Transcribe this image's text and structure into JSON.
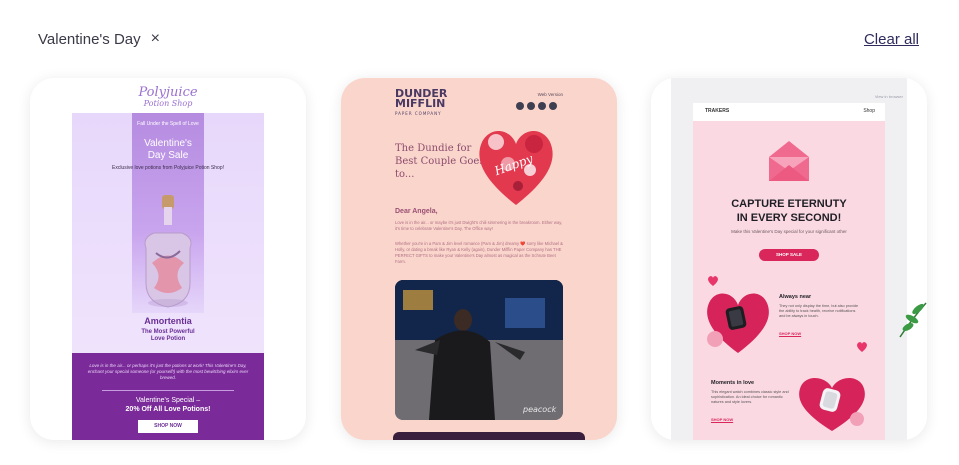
{
  "filter": {
    "chip_label": "Valentine's Day",
    "close_glyph": "×",
    "clear_label": "Clear all"
  },
  "cards": {
    "polyjuice": {
      "logo": "Polyjuice",
      "logo_sub": "Potion Shop",
      "kicker": "Fall Under the Spell of Love",
      "title_line1": "Valentine's",
      "title_line2": "Day Sale",
      "intro": "Exclusive love potions from Polyjuice Potion Shop!",
      "product": "Amortentia",
      "product_sub_1": "The Most Powerful",
      "product_sub_2": "Love Potion",
      "body": "Love is in the air... or perhaps it's just the potions at work! This Valentine's Day, enchant your special someone (or yourself!) with the most bewitching elixirs ever brewed.",
      "promo_1": "Valentine's Special –",
      "promo_2": "20% Off All Love Potions!",
      "cta": "SHOP NOW"
    },
    "dunder": {
      "logo_1": "DUNDER",
      "logo_2": "MIFFLIN",
      "logo_sub": "PAPER COMPANY",
      "web_version": "Web Version",
      "headline": "The Dundie for Best Couple Goes to...",
      "greeting": "Dear Angela,",
      "p1": "Love is in the air... or maybe it's just Dwight's chili simmering in the breakroom. Either way, it's time to celebrate Valentine's Day, The Office way!",
      "p2": "Whether you're in a Pam & Jim level romance (Pam & Jim) dreamy ❤️ sorry like Michael & Holly, or dating a break like Ryan & Kelly (again), Dunder Mifflin Paper Company has THE PERFECT GIFTS to make your Valentine's Day almost as magical as the Schrute Beet Farm.",
      "watermark": "peacock"
    },
    "trakers": {
      "view_online": "View in browser",
      "brand": "TRAKERS",
      "shop": "Shop",
      "title_1": "CAPTURE ETERNUTY",
      "title_2": "IN EVERY SECOND!",
      "subtitle": "Make this Valentine's Day special for your significant other",
      "cta": "SHOP SALE",
      "f1_title": "Always near",
      "f1_body": "They not only display the time, but also provide the ability to track health, receive notifications and be always in touch.",
      "f1_link": "SHOP NOW",
      "f2_title": "Moments in love",
      "f2_body": "This elegant watch combines classic style and sophistication. An ideal choice for romantic natures and style lovers.",
      "f2_link": "SHOP NOW"
    }
  }
}
